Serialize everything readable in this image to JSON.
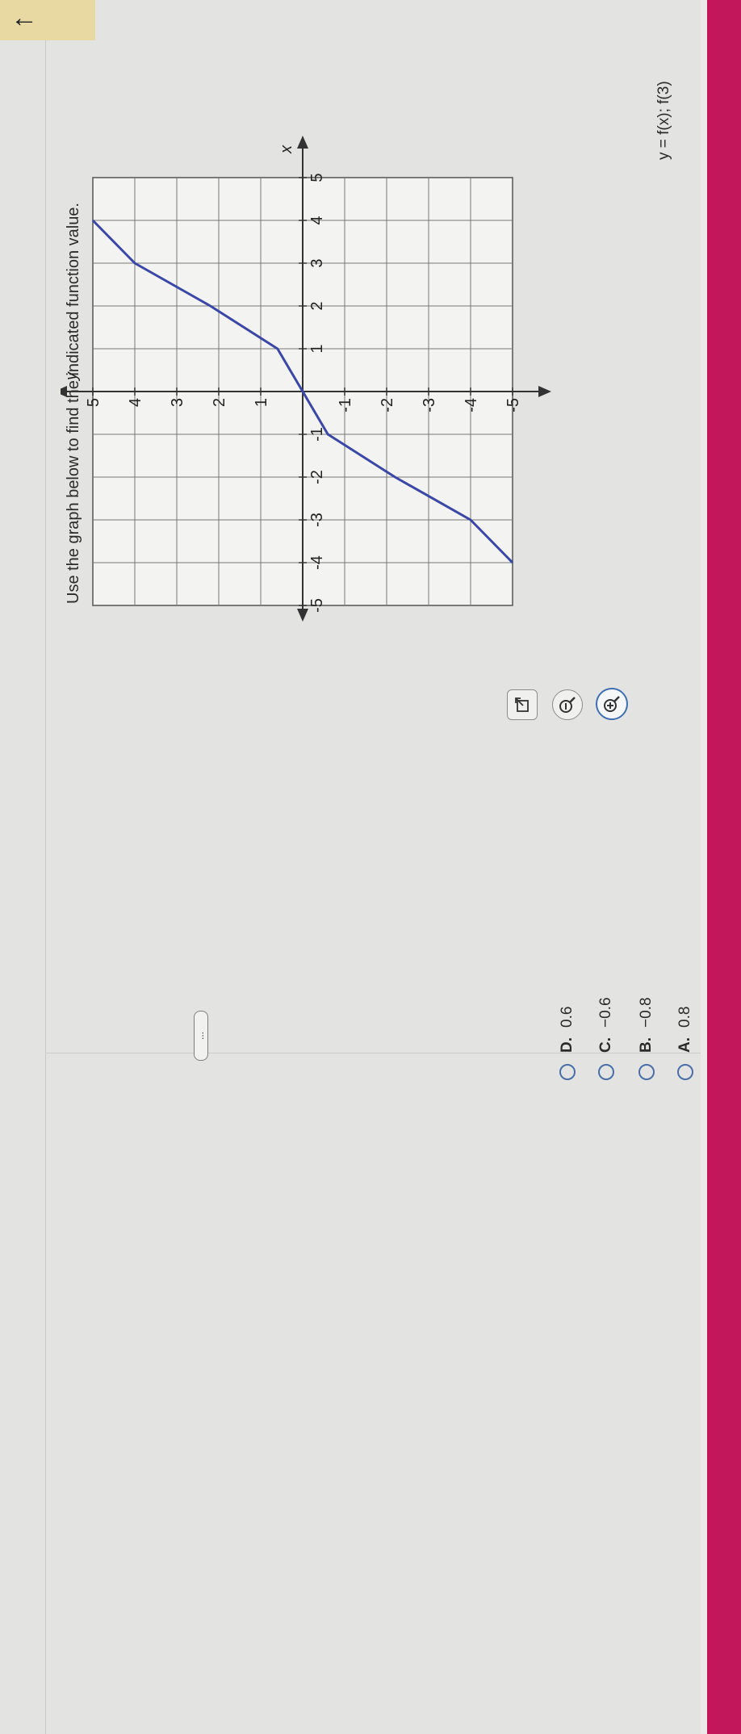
{
  "header": {
    "back_icon": "arrow-left-icon"
  },
  "question": {
    "prompt": "Use the graph below to find the indicated function value.",
    "function_text": "y = f(x); f(3)"
  },
  "toolbar": {
    "zoom_in_icon": "zoom-in-icon",
    "zoom_out_icon": "zoom-out-icon",
    "popout_icon": "popout-icon"
  },
  "more_label": "...",
  "options": [
    {
      "letter": "A.",
      "value": "0.8"
    },
    {
      "letter": "B.",
      "value": "−0.8"
    },
    {
      "letter": "C.",
      "value": "−0.6"
    },
    {
      "letter": "D.",
      "value": "0.6"
    }
  ],
  "colors": {
    "accent": "#c2185b",
    "curve": "#3a47a6",
    "radio": "#4a6fa8"
  },
  "chart_data": {
    "type": "line",
    "xlabel": "x",
    "ylabel": "y",
    "xlim": [
      -5,
      5
    ],
    "ylim": [
      -5,
      5
    ],
    "grid": true,
    "x_ticks": [
      "-5",
      "-4",
      "-3",
      "-2",
      "-1",
      "1",
      "2",
      "3",
      "4",
      "5"
    ],
    "y_ticks": [
      "-5",
      "-4",
      "-3",
      "-2",
      "-1",
      "1",
      "2",
      "3",
      "4",
      "5"
    ],
    "series": [
      {
        "x": [
          -4,
          -3,
          -2,
          -1,
          0,
          1,
          2,
          3,
          4
        ],
        "y": [
          -5,
          -4,
          -2.2,
          -0.6,
          0,
          0.6,
          2.2,
          4,
          5
        ]
      }
    ]
  }
}
